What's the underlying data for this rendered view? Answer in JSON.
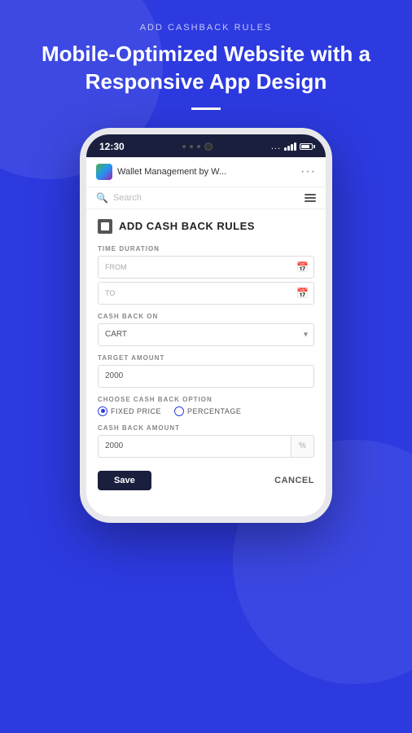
{
  "page": {
    "top_label": "ADD CASHBACK RULES",
    "hero_title": "Mobile-Optimized Website with a Responsive App Design"
  },
  "phone": {
    "time": "12:30",
    "status_dots": "...",
    "app_title": "Wallet Management by W...",
    "search_placeholder": "Search"
  },
  "form": {
    "section_title": "ADD CASH BACK RULES",
    "time_duration_label": "TIME DURATION",
    "from_label": "FROM",
    "to_label": "TO",
    "cashback_on_label": "CASH BACK ON",
    "cashback_on_value": "CART",
    "target_amount_label": "TARGET AMOUNT",
    "target_amount_value": "2000",
    "choose_option_label": "CHOOSE CASH BACK OPTION",
    "fixed_price_label": "FIXED PRICE",
    "percentage_label": "PERCENTAGE",
    "cashback_amount_label": "CASH BACK  AMOUNT",
    "cashback_amount_value": "2000",
    "percent_symbol": "%",
    "save_label": "Save",
    "cancel_label": "CANCEL"
  }
}
